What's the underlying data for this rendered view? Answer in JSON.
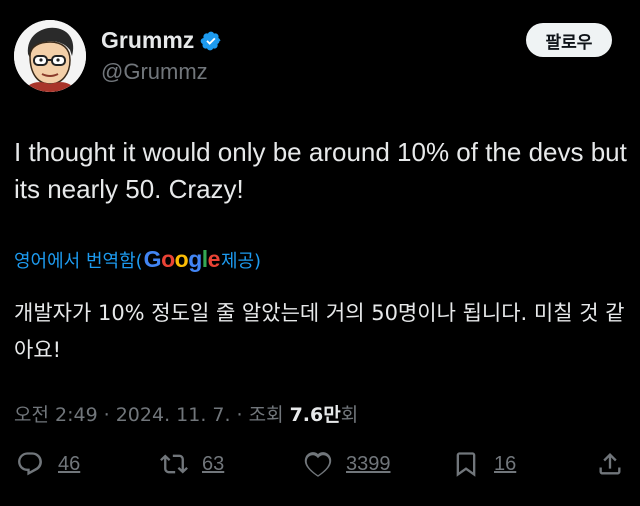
{
  "author": {
    "display_name": "Grummz",
    "handle": "@Grummz",
    "verified": true,
    "verified_color": "#1d9bf0"
  },
  "follow_button": {
    "label": "팔로우"
  },
  "tweet": {
    "text": "I thought it would only be around 10% of the devs but its nearly 50. Crazy!"
  },
  "translation": {
    "prefix": "영어에서 번역함(",
    "google": {
      "G": "G",
      "o1": "o",
      "o2": "o",
      "g": "g",
      "l": "l",
      "e": "e"
    },
    "suffix": " 제공)",
    "text": "개발자가 10% 정도일 줄 알았는데 거의 50명이나 됩니다. 미칠 것 같아요!"
  },
  "meta": {
    "time": "오전 2:49",
    "date": "2024. 11. 7.",
    "views_label": "조회",
    "views_count": "7.6만",
    "views_unit": "회",
    "separator": "·"
  },
  "actions": {
    "replies": "46",
    "reposts": "63",
    "likes": "3399",
    "bookmarks": "16"
  },
  "icons": [
    "reply-icon",
    "repost-icon",
    "like-icon",
    "bookmark-icon",
    "share-icon",
    "verified-badge-icon"
  ],
  "colors": {
    "background": "#000000",
    "text": "#e7e9ea",
    "secondary": "#71767b",
    "link": "#1d9bf0"
  }
}
